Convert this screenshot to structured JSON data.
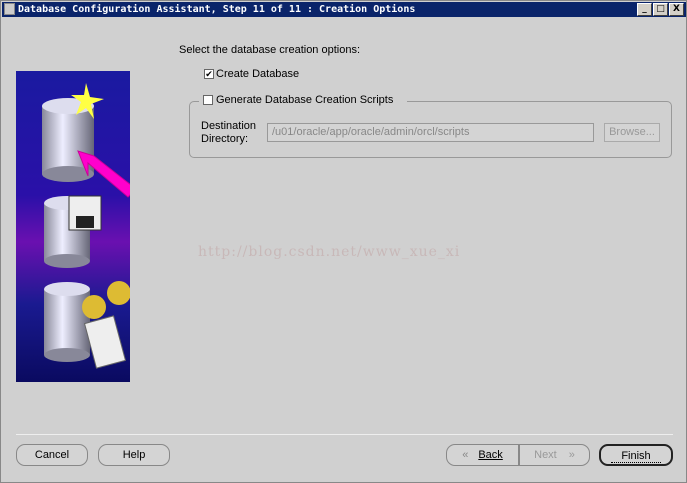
{
  "window": {
    "title": "Database Configuration Assistant, Step 11 of 11 : Creation Options",
    "minimize": "_",
    "maximize": "□",
    "close": "X"
  },
  "main": {
    "prompt": "Select the database creation options:",
    "create_database": {
      "label": "Create Database",
      "checked": true,
      "mark": "✔"
    },
    "generate_scripts": {
      "label": "Generate Database Creation Scripts",
      "checked": false
    },
    "destination_label_1": "Destination",
    "destination_label_2": "Directory:",
    "destination_value": "/u01/oracle/app/oracle/admin/orcl/scripts",
    "browse_label": "Browse..."
  },
  "watermark": "http://blog.csdn.net/www_xue_xi",
  "buttons": {
    "cancel": "Cancel",
    "help": "Help",
    "back": "Back",
    "back_icon": "«",
    "next": "Next",
    "next_icon": "»",
    "finish": "Finish"
  }
}
